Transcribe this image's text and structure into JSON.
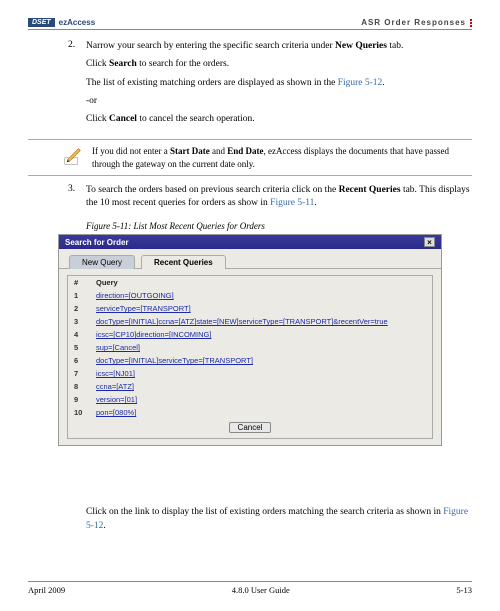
{
  "header": {
    "logo_badge": "DSET",
    "logo_text": "ezAccess",
    "right_text": "ASR Order Responses"
  },
  "step2": {
    "num": "2.",
    "line1_a": "Narrow your search by entering the specific search criteria under ",
    "line1_b": "New Queries",
    "line1_c": " tab.",
    "line2_a": "Click ",
    "line2_b": "Search",
    "line2_c": " to search for the orders.",
    "line3_a": "The list of existing matching orders are displayed as shown in the ",
    "line3_link": "Figure 5-12",
    "line3_b": ".",
    "line4": "-or",
    "line5_a": "Click ",
    "line5_b": "Cancel",
    "line5_c": " to cancel the search operation."
  },
  "note": {
    "a": "If you did not enter a ",
    "b1": "Start Date",
    "c": " and ",
    "b2": "End Date",
    "d": ", ezAccess displays the documents that have passed through the gateway on the current date only."
  },
  "step3": {
    "num": "3.",
    "line1_a": "To search the orders based on previous search criteria click on the ",
    "line1_b": "Recent Queries",
    "line1_c": " tab. This displays the 10 most recent queries for orders as show in ",
    "line1_link": "Figure 5-11",
    "line1_d": "."
  },
  "figure_caption": "Figure 5-11:  List Most Recent Queries for Orders",
  "window": {
    "title": "Search for Order",
    "close": "×",
    "tab_new": "New Query",
    "tab_recent": "Recent Queries",
    "col_num": "#",
    "col_query": "Query",
    "rows": [
      {
        "n": "1",
        "q": "direction=[OUTGOING]"
      },
      {
        "n": "2",
        "q": "serviceType=[TRANSPORT]"
      },
      {
        "n": "3",
        "q": "docType=[INITIAL]ccna=[ATZ]state=[NEW]serviceType=[TRANSPORT]&recentVer=true"
      },
      {
        "n": "4",
        "q": "icsc=[CP10]direction=[INCOMING]"
      },
      {
        "n": "5",
        "q": "sup=[Cancel]"
      },
      {
        "n": "6",
        "q": "docType=[INITIAL]serviceType=[TRANSPORT]"
      },
      {
        "n": "7",
        "q": "icsc=[NJ01]"
      },
      {
        "n": "8",
        "q": "ccna=[ATZ]"
      },
      {
        "n": "9",
        "q": "version=[01]"
      },
      {
        "n": "10",
        "q": "pon=[080%]"
      }
    ],
    "cancel_label": "Cancel"
  },
  "after": {
    "a": "Click on the link to display the list of existing orders matching the search criteria as shown in ",
    "link": "Figure 5-12",
    "b": "."
  },
  "footer": {
    "left": "April 2009",
    "center": "4.8.0 User Guide",
    "right": "5-13"
  }
}
